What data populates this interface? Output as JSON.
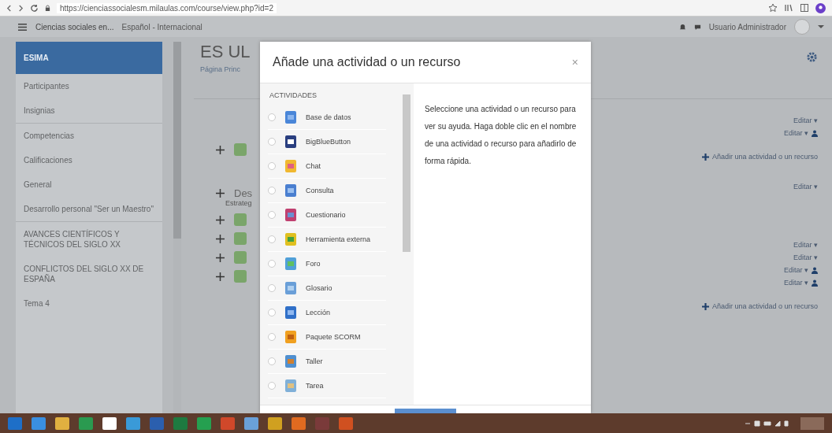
{
  "browser": {
    "url": "https://cienciassocialesm.milaulas.com/course/view.php?id=2"
  },
  "navbar": {
    "site_name": "Ciencias sociales en...",
    "language": "Español - Internacional",
    "user": "Usuario Administrador"
  },
  "sidebar": {
    "items": [
      {
        "label": "ESIMA",
        "selected": true
      },
      {
        "label": "Participantes",
        "selected": false
      },
      {
        "label": "Insignias",
        "selected": false
      },
      {
        "label": "Competencias",
        "selected": false
      },
      {
        "label": "Calificaciones",
        "selected": false
      },
      {
        "label": "General",
        "selected": false
      },
      {
        "label": "Desarrollo personal \"Ser un Maestro\"",
        "selected": false
      },
      {
        "label": "AVANCES CIENTÍFICOS Y TÉCNICOS DEL SIGLO XX",
        "selected": false
      },
      {
        "label": "CONFLICTOS DEL SIGLO XX DE ESPAÑA",
        "selected": false
      },
      {
        "label": "Tema 4",
        "selected": false
      }
    ]
  },
  "course": {
    "title": "ES UL",
    "breadcrumb": "Página Princ",
    "right_links": [
      {
        "kind": "menu",
        "label": "Editar ▾"
      },
      {
        "kind": "user",
        "label": "Editar ▾"
      },
      {
        "kind": "add",
        "label": "Añadir una actividad o un recurso"
      },
      {
        "kind": "menu",
        "label": "Editar ▾"
      },
      {
        "kind": "menu",
        "label": "Editar ▾"
      },
      {
        "kind": "menu",
        "label": "Editar ▾"
      },
      {
        "kind": "user",
        "label": "Editar ▾"
      },
      {
        "kind": "user",
        "label": "Editar ▾"
      },
      {
        "kind": "add",
        "label": "Añadir una actividad o un recurso"
      }
    ],
    "section_heading": "Des",
    "section_note": "Estrateg"
  },
  "dialog": {
    "title": "Añade una actividad o un recurso",
    "close": "×",
    "list_heading": "ACTIVIDADES",
    "activities": [
      {
        "label": "Base de datos",
        "selected": false
      },
      {
        "label": "BigBlueButton",
        "selected": false
      },
      {
        "label": "Chat",
        "selected": false
      },
      {
        "label": "Consulta",
        "selected": false
      },
      {
        "label": "Cuestionario",
        "selected": false
      },
      {
        "label": "Herramienta externa",
        "selected": false
      },
      {
        "label": "Foro",
        "selected": false
      },
      {
        "label": "Glosario",
        "selected": false
      },
      {
        "label": "Lección",
        "selected": false
      },
      {
        "label": "Paquete SCORM",
        "selected": false
      },
      {
        "label": "Taller",
        "selected": false
      },
      {
        "label": "Tarea",
        "selected": false
      }
    ],
    "help": "Seleccione una actividad o un recurso para ver su ayuda. Haga doble clic en el nombre de una actividad o recurso para añadirlo de forma rápida."
  }
}
